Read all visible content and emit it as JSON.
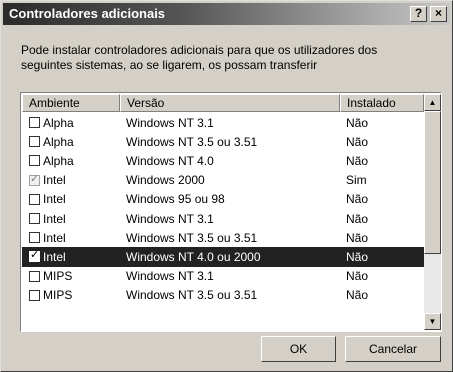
{
  "window": {
    "title": "Controladores adicionais",
    "help_label": "?",
    "close_label": "×"
  },
  "description": "Pode instalar controladores adicionais para que os utilizadores dos seguintes sistemas, ao se ligarem, os possam transferir",
  "table": {
    "headers": [
      "Ambiente",
      "Versão",
      "Instalado"
    ],
    "rows": [
      {
        "checked": false,
        "disabled": false,
        "selected": false,
        "environment": "Alpha",
        "version": "Windows NT 3.1",
        "installed": "Não"
      },
      {
        "checked": false,
        "disabled": false,
        "selected": false,
        "environment": "Alpha",
        "version": "Windows NT 3.5 ou 3.51",
        "installed": "Não"
      },
      {
        "checked": false,
        "disabled": false,
        "selected": false,
        "environment": "Alpha",
        "version": "Windows NT 4.0",
        "installed": "Não"
      },
      {
        "checked": true,
        "disabled": true,
        "selected": false,
        "environment": "Intel",
        "version": "Windows 2000",
        "installed": "Sim"
      },
      {
        "checked": false,
        "disabled": false,
        "selected": false,
        "environment": "Intel",
        "version": "Windows 95 ou 98",
        "installed": "Não"
      },
      {
        "checked": false,
        "disabled": false,
        "selected": false,
        "environment": "Intel",
        "version": "Windows NT 3.1",
        "installed": "Não"
      },
      {
        "checked": false,
        "disabled": false,
        "selected": false,
        "environment": "Intel",
        "version": "Windows NT 3.5 ou 3.51",
        "installed": "Não"
      },
      {
        "checked": true,
        "disabled": false,
        "selected": true,
        "environment": "Intel",
        "version": "Windows NT 4.0 ou 2000",
        "installed": "Não"
      },
      {
        "checked": false,
        "disabled": false,
        "selected": false,
        "environment": "MIPS",
        "version": "Windows NT 3.1",
        "installed": "Não"
      },
      {
        "checked": false,
        "disabled": false,
        "selected": false,
        "environment": "MIPS",
        "version": "Windows NT 3.5 ou 3.51",
        "installed": "Não"
      }
    ]
  },
  "scrollbar": {
    "up_icon": "arrow-up-icon",
    "down_icon": "arrow-down-icon"
  },
  "buttons": {
    "ok_label": "OK",
    "cancel_label": "Cancelar"
  }
}
